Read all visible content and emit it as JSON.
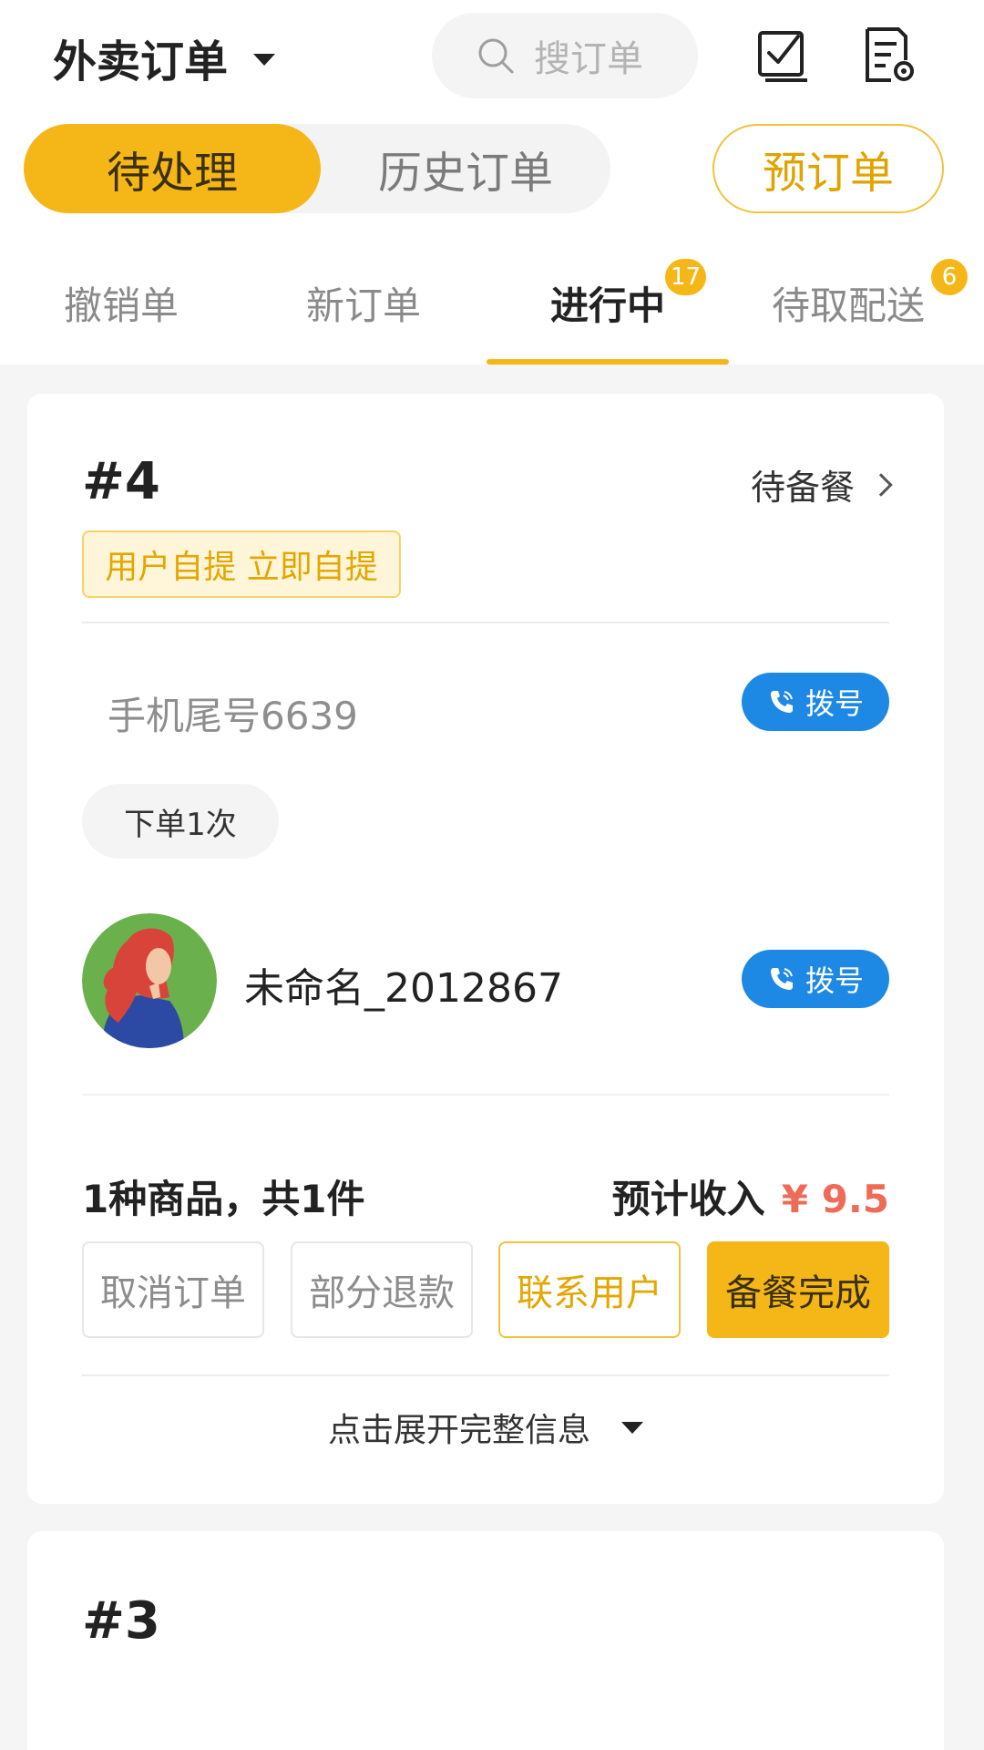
{
  "header": {
    "title": "外卖订单",
    "search_placeholder": "搜订单",
    "icons": [
      "checkbox-icon",
      "document-settings-icon"
    ]
  },
  "segments": {
    "active": "待处理",
    "inactive": "历史订单",
    "pre_order": "预订单"
  },
  "tabs": [
    {
      "label": "撤销单"
    },
    {
      "label": "新订单"
    },
    {
      "label": "进行中",
      "badge": "17"
    },
    {
      "label": "待取配送",
      "badge": "6"
    }
  ],
  "orders": [
    {
      "number": "#4",
      "status": "待备餐",
      "tag": "用户自提 立即自提",
      "phone_tail": "手机尾号6639",
      "dial_label": "拨号",
      "order_count": "下单1次",
      "username": "未命名_2012867",
      "summary": "1种商品，共1件",
      "income_label": "预计收入",
      "income_amount": "¥ 9.5",
      "actions": [
        "取消订单",
        "部分退款",
        "联系用户",
        "备餐完成"
      ],
      "expand_label": "点击展开完整信息"
    },
    {
      "number": "#3"
    }
  ],
  "colors": {
    "accent": "#f5b718",
    "dial_blue": "#1e88e5",
    "income_red": "#ee6b57"
  }
}
